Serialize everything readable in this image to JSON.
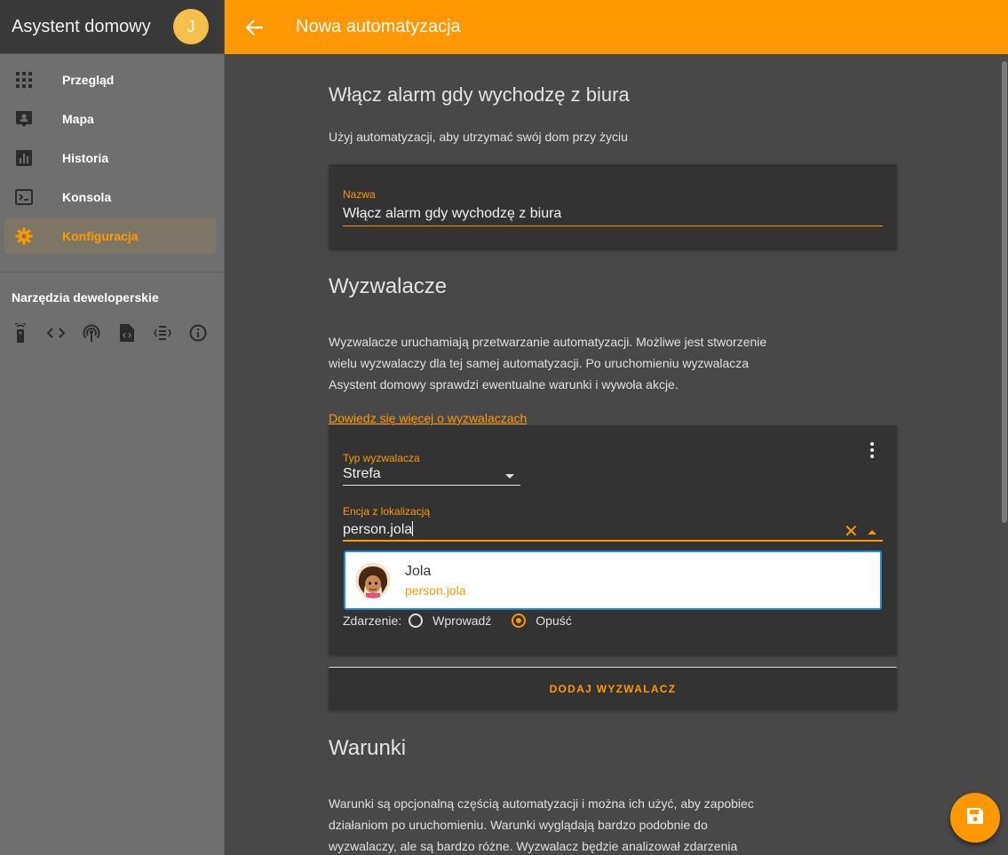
{
  "sidebar": {
    "title": "Asystent domowy",
    "avatar_initial": "J",
    "items": [
      {
        "label": "Przegląd",
        "icon": "grid-icon"
      },
      {
        "label": "Mapa",
        "icon": "map-person-icon"
      },
      {
        "label": "Historia",
        "icon": "chart-icon"
      },
      {
        "label": "Konsola",
        "icon": "console-icon"
      },
      {
        "label": "Konfiguracja",
        "icon": "gear-icon",
        "active": true
      }
    ],
    "dev_section": "Narzędzia deweloperskie",
    "dev_tools": [
      "remote-icon",
      "code-icon",
      "antenna-icon",
      "file-code-icon",
      "template-icon",
      "info-icon"
    ]
  },
  "topbar": {
    "title": "Nowa automatyzacja"
  },
  "main": {
    "heading": "Włącz alarm gdy wychodzę z biura",
    "subheading": "Użyj automatyzacji, aby utrzymać swój dom przy życiu",
    "name_field": {
      "label": "Nazwa",
      "value": "Włącz alarm gdy wychodzę z biura"
    },
    "triggers": {
      "title": "Wyzwalacze",
      "description_lines": [
        "Wyzwalacze uruchamiają przetwarzanie automatyzacji. Możliwe jest stworzenie",
        "wielu wyzwalaczy dla tej samej automatyzacji. Po uruchomieniu wyzwalacza",
        "Asystent domowy sprawdzi ewentualne warunki i wywoła akcje."
      ],
      "learn_more": "Dowiedz się więcej o wyzwalaczach",
      "trigger_type_label": "Typ wyzwalacza",
      "trigger_type_value": "Strefa",
      "entity_label": "Encja z lokalizacją",
      "entity_value": "person.jola",
      "suggestion": {
        "name": "Jola",
        "entity": "person.jola"
      },
      "event_label": "Zdarzenie:",
      "event_options": [
        {
          "label": "Wprowadź",
          "selected": false
        },
        {
          "label": "Opuść",
          "selected": true
        }
      ],
      "add_button": "DODAJ WYZWALACZ"
    },
    "conditions": {
      "title": "Warunki",
      "description_lines": [
        "Warunki są opcjonalną częścią automatyzacji i można ich użyć, aby zapobiec",
        "działaniom po uruchomieniu. Warunki wyglądają bardzo podobnie do",
        "wyzwalaczy, ale są bardzo różne. Wyzwalacz będzie analizował zdarzenia"
      ]
    }
  },
  "fab": {
    "icon": "save-icon"
  },
  "colors": {
    "accent": "#ff9800",
    "sidebar_bg": "#6f6f6f",
    "content_bg": "#484848",
    "card_bg": "#333333",
    "highlight_border": "#1e88e5"
  }
}
